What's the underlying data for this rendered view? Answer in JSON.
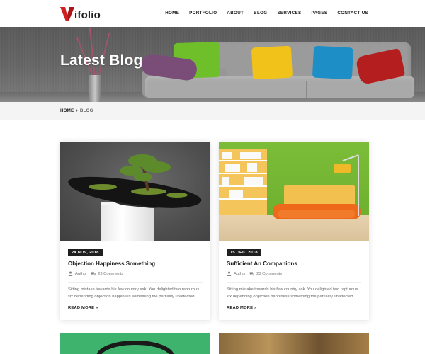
{
  "brand": {
    "logo_text": "ifolio",
    "accent": "#d0201f"
  },
  "nav": {
    "items": [
      {
        "label": "HOME"
      },
      {
        "label": "PORTFOLIO"
      },
      {
        "label": "ABOUT"
      },
      {
        "label": "BLOG"
      },
      {
        "label": "SERVICES"
      },
      {
        "label": "PAGES"
      },
      {
        "label": "CONTACT US"
      }
    ]
  },
  "hero": {
    "title": "Latest Blog"
  },
  "breadcrumb": {
    "home": "HOME",
    "separator": "›",
    "current": "BLOG"
  },
  "posts": [
    {
      "date": "24 NOV, 2018",
      "title": "Objection Happiness Something",
      "author": "Author",
      "comments": "23 Comments",
      "excerpt": "Sitting mistake towards his few country ask. You delighted two rapturous six depending objection happiness something the partiality unaffected",
      "read_more": "READ MORE »",
      "image": "bonsai"
    },
    {
      "date": "15 DEC, 2018",
      "title": "Sufficient An Companions",
      "author": "Author",
      "comments": "23 Comments",
      "excerpt": "Sitting mistake towards his few country ask. You delighted two rapturous six depending objection happiness something the partiality unaffected",
      "read_more": "READ MORE »",
      "image": "living-room"
    }
  ],
  "icons": {
    "author": "user-icon",
    "comments": "comments-icon"
  },
  "colors": {
    "dark": "#1f1f1f",
    "muted": "#777777",
    "breadcrumb_bg": "#f4f4f4"
  }
}
